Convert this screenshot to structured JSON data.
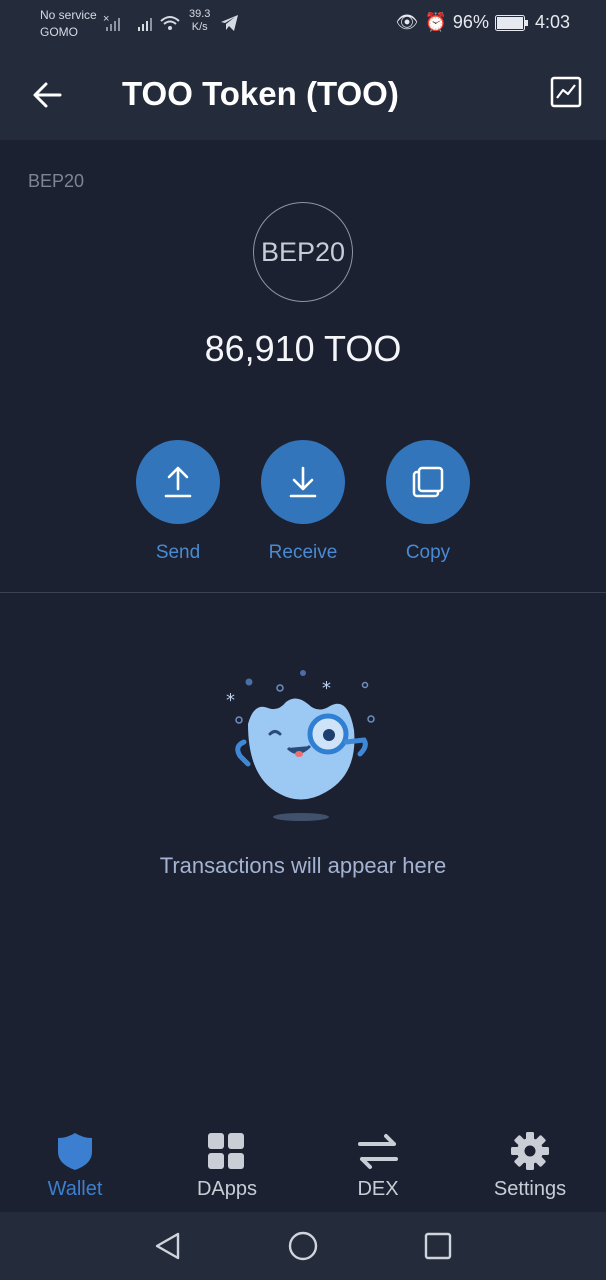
{
  "status_bar": {
    "carrier_line1": "No service",
    "carrier_line2": "GOMO",
    "speed_value": "39.3",
    "speed_unit": "K/s",
    "battery": "96%",
    "time": "4:03"
  },
  "header": {
    "title": "TOO Token (TOO)"
  },
  "token": {
    "network_label": "BEP20",
    "icon_text": "BEP20",
    "balance": "86,910 TOO"
  },
  "actions": [
    {
      "label": "Send",
      "icon": "arrow-up-icon"
    },
    {
      "label": "Receive",
      "icon": "arrow-down-icon"
    },
    {
      "label": "Copy",
      "icon": "copy-icon"
    }
  ],
  "empty_state": {
    "message": "Transactions will appear here"
  },
  "bottom_nav": [
    {
      "label": "Wallet",
      "icon": "shield-icon",
      "active": true
    },
    {
      "label": "DApps",
      "icon": "grid-icon",
      "active": false
    },
    {
      "label": "DEX",
      "icon": "swap-icon",
      "active": false
    },
    {
      "label": "Settings",
      "icon": "gear-icon",
      "active": false
    }
  ],
  "colors": {
    "background": "#1b2130",
    "bar": "#242b3b",
    "accent": "#3375bb",
    "accent_text": "#4a8ad2"
  }
}
